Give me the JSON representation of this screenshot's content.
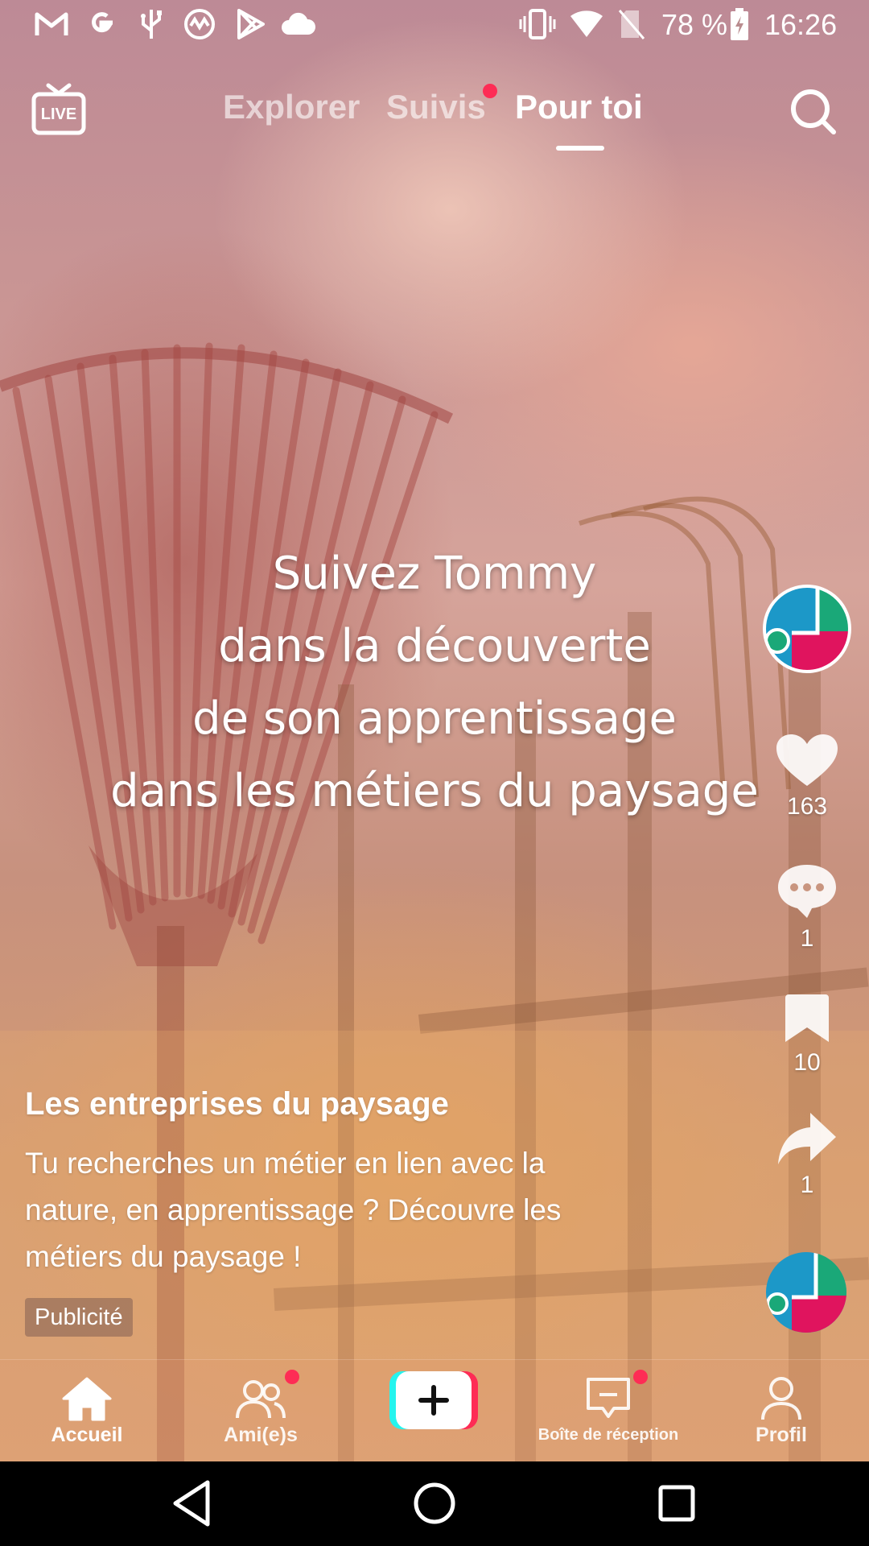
{
  "status_bar": {
    "icons": [
      "gmail-icon",
      "google-icon",
      "usb-icon",
      "app-icon",
      "play-store-icon",
      "cloud-icon",
      "vibrate-icon",
      "wifi-icon",
      "no-sim-icon",
      "battery-charging-icon"
    ],
    "battery": "78 %",
    "time": "16:26"
  },
  "top_nav": {
    "live_label": "LIVE",
    "tabs": [
      {
        "label": "Explorer",
        "active": false
      },
      {
        "label": "Suivis",
        "active": false,
        "notification_dot": true
      },
      {
        "label": "Pour toi",
        "active": true
      }
    ]
  },
  "video": {
    "caption_lines": [
      "Suivez Tommy",
      "dans la découverte",
      "de son apprentissage",
      "dans les métiers du paysage"
    ]
  },
  "actions": {
    "likes": "163",
    "comments": "1",
    "saves": "10",
    "shares": "1"
  },
  "post": {
    "author": "Les entreprises du paysage",
    "description": "Tu recherches un métier en lien avec la nature, en apprentissage ? Découvre les métiers du paysage !",
    "ad_label": "Publicité"
  },
  "bottom_nav": {
    "items": [
      {
        "label": "Accueil",
        "icon": "home-icon",
        "active": true
      },
      {
        "label": "Ami(e)s",
        "icon": "friends-icon",
        "notification_dot": true
      },
      {
        "label": "",
        "icon": "plus-icon"
      },
      {
        "label": "Boîte de réception",
        "icon": "inbox-icon",
        "notification_dot": true
      },
      {
        "label": "Profil",
        "icon": "profile-icon"
      }
    ]
  },
  "colors": {
    "accent_red": "#fe2c55",
    "accent_cyan": "#25f4ee",
    "avatar_blue": "#1c98c8",
    "avatar_green": "#1aa878",
    "avatar_pink": "#e0145e"
  }
}
